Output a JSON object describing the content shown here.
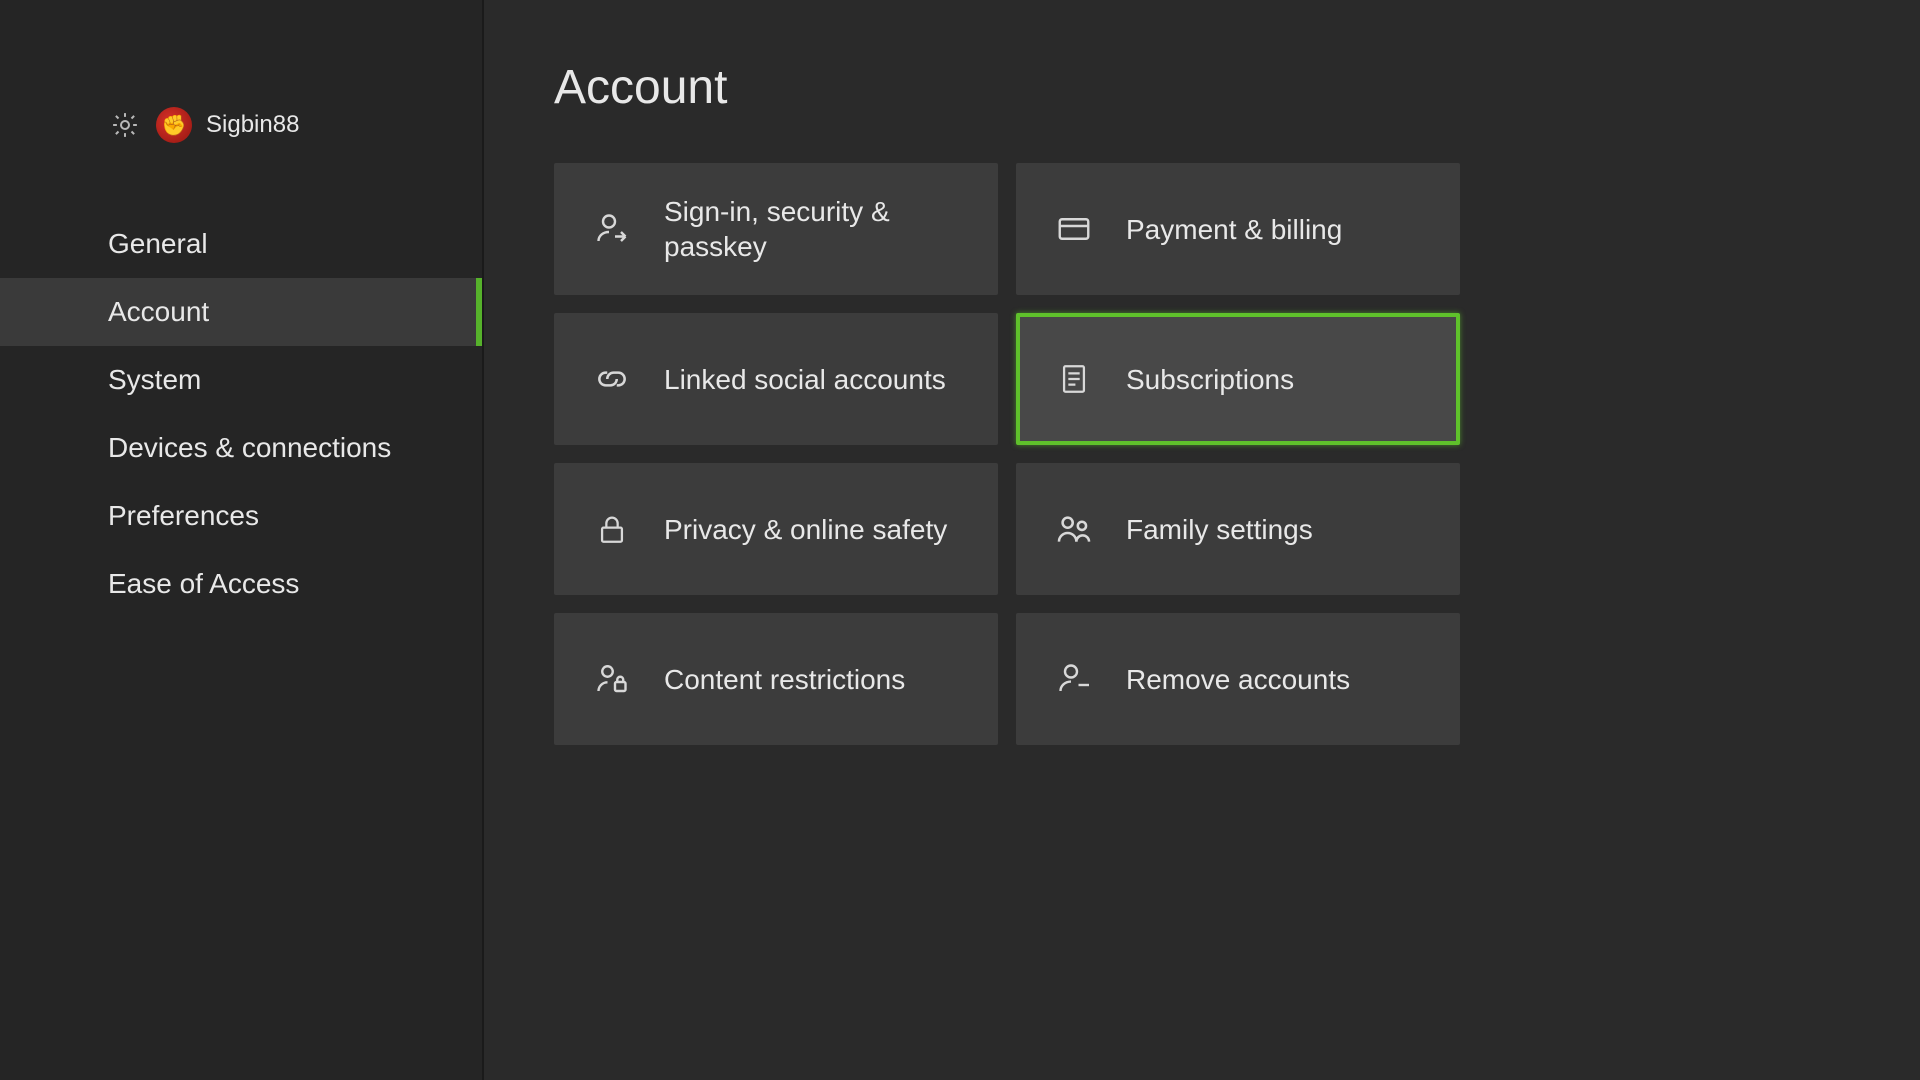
{
  "header": {
    "username": "Sigbin88"
  },
  "sidebar": {
    "items": [
      {
        "label": "General",
        "active": false
      },
      {
        "label": "Account",
        "active": true
      },
      {
        "label": "System",
        "active": false
      },
      {
        "label": "Devices & connections",
        "active": false
      },
      {
        "label": "Preferences",
        "active": false
      },
      {
        "label": "Ease of Access",
        "active": false
      }
    ]
  },
  "main": {
    "title": "Account",
    "tiles": [
      {
        "label": "Sign-in, security & passkey",
        "icon": "person-arrow-icon",
        "selected": false
      },
      {
        "label": "Payment & billing",
        "icon": "credit-card-icon",
        "selected": false
      },
      {
        "label": "Linked social accounts",
        "icon": "link-icon",
        "selected": false
      },
      {
        "label": "Subscriptions",
        "icon": "receipt-icon",
        "selected": true
      },
      {
        "label": "Privacy & online safety",
        "icon": "lock-icon",
        "selected": false
      },
      {
        "label": "Family settings",
        "icon": "people-icon",
        "selected": false
      },
      {
        "label": "Content restrictions",
        "icon": "person-lock-icon",
        "selected": false
      },
      {
        "label": "Remove accounts",
        "icon": "person-minus-icon",
        "selected": false
      }
    ]
  }
}
